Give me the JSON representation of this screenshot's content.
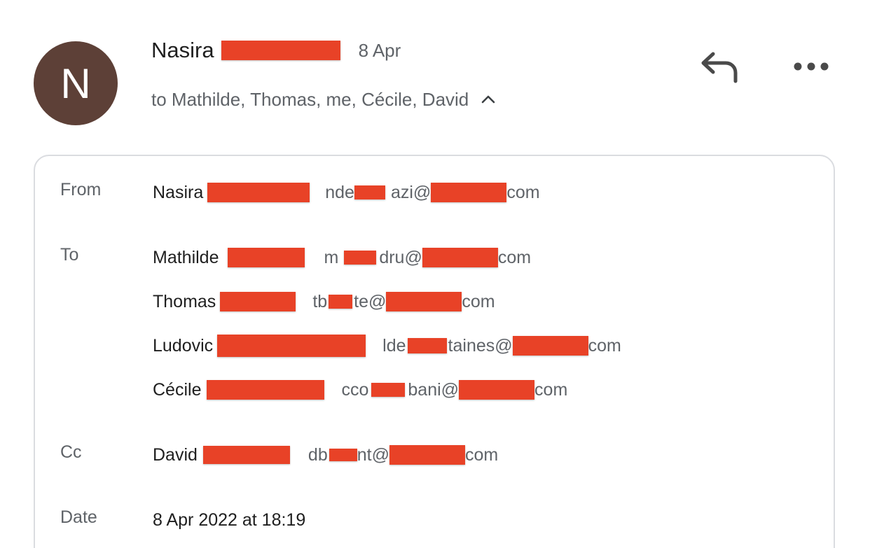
{
  "header": {
    "avatar_letter": "N",
    "avatar_color": "#5d4037",
    "sender_name": "Nasira",
    "date_short": "8 Apr",
    "recipients_summary": "to Mathilde, Thomas, me, Cécile, David",
    "redaction_color": "#e84227"
  },
  "actions": {
    "reply_icon": "reply-icon",
    "more_icon": "more-horizontal-icon",
    "expand_icon": "chevron-up-icon"
  },
  "details": {
    "from_label": "From",
    "to_label": "To",
    "cc_label": "Cc",
    "date_label": "Date",
    "from": {
      "name": "Nasira",
      "email_start": "nde",
      "email_mid": "azi@",
      "email_end": "com"
    },
    "to": [
      {
        "name": "Mathilde",
        "email_start": "m",
        "email_mid": "dru@",
        "email_end": "com"
      },
      {
        "name": "Thomas",
        "email_start": "tb",
        "email_mid": "te@",
        "email_end": "com"
      },
      {
        "name": "Ludovic",
        "email_start": "lde",
        "email_mid": "taines@",
        "email_end": "com"
      },
      {
        "name": "Cécile",
        "email_start": "cco",
        "email_mid": "bani@",
        "email_end": "com"
      }
    ],
    "cc": {
      "name": "David",
      "email_start": "db",
      "email_mid": "nt@",
      "email_end": "com"
    },
    "date_full": "8 Apr 2022 at 18:19"
  }
}
